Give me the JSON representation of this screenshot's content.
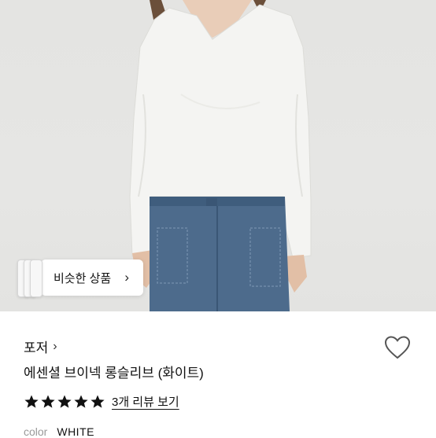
{
  "similar_products": {
    "label": "비슷한 상품",
    "chevron": "chevron-right-icon"
  },
  "product": {
    "brand": "포저",
    "brand_chevron": "chevron-right-icon",
    "name": "에센셜 브이넥 롱슬리브 (화이트)",
    "rating_stars": 5,
    "review_link": "3개 리뷰 보기",
    "color_label": "color",
    "color_value": "WHITE",
    "wishlist_icon": "heart-outline-icon"
  },
  "colors": {
    "star": "#111111",
    "heart": "#555555",
    "shirt": "#f4f4f2",
    "jeans": "#4d6b8c"
  }
}
